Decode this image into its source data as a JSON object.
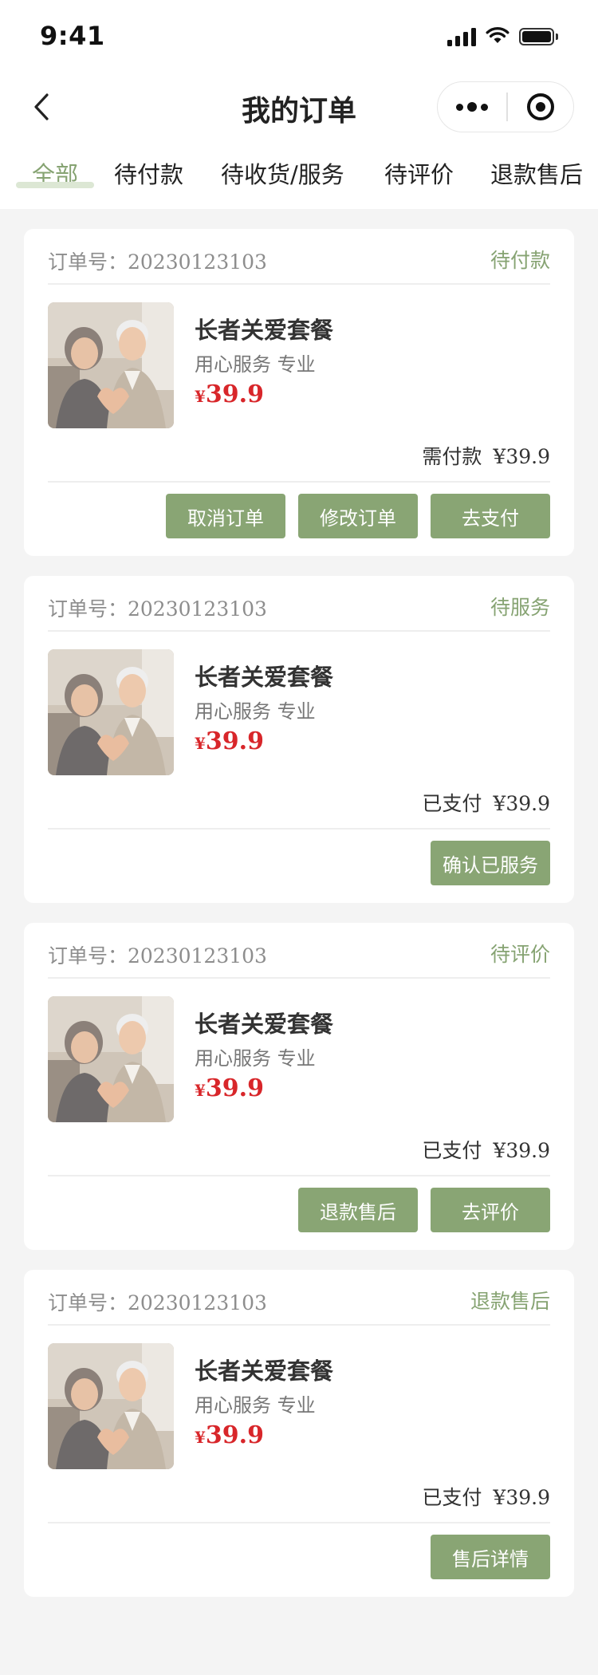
{
  "status_bar": {
    "time": "9:41"
  },
  "nav": {
    "title": "我的订单"
  },
  "tabs": [
    {
      "label": "全部",
      "active": true
    },
    {
      "label": "待付款"
    },
    {
      "label": "待收货/服务"
    },
    {
      "label": "待评价"
    },
    {
      "label": "退款售后"
    }
  ],
  "colors": {
    "accent": "#86a372",
    "button": "#89a574",
    "price": "#d8262a",
    "background": "#f4f4f4"
  },
  "orders": [
    {
      "order_label": "订单号：20230123103",
      "status": "待付款",
      "product_name": "长者关爱套餐",
      "product_desc": "用心服务 专业",
      "price_symbol": "¥",
      "price": "39.9",
      "pay_label": "需付款",
      "pay_amount": "¥39.9",
      "buttons": [
        "取消订单",
        "修改订单",
        "去支付"
      ]
    },
    {
      "order_label": "订单号：20230123103",
      "status": "待服务",
      "product_name": "长者关爱套餐",
      "product_desc": "用心服务 专业",
      "price_symbol": "¥",
      "price": "39.9",
      "pay_label": "已支付",
      "pay_amount": "¥39.9",
      "buttons": [
        "确认已服务"
      ]
    },
    {
      "order_label": "订单号：20230123103",
      "status": "待评价",
      "product_name": "长者关爱套餐",
      "product_desc": "用心服务 专业",
      "price_symbol": "¥",
      "price": "39.9",
      "pay_label": "已支付",
      "pay_amount": "¥39.9",
      "buttons": [
        "退款售后",
        "去评价"
      ]
    },
    {
      "order_label": "订单号：20230123103",
      "status": "退款售后",
      "product_name": "长者关爱套餐",
      "product_desc": "用心服务 专业",
      "price_symbol": "¥",
      "price": "39.9",
      "pay_label": "已支付",
      "pay_amount": "¥39.9",
      "buttons": [
        "售后详情"
      ]
    }
  ]
}
